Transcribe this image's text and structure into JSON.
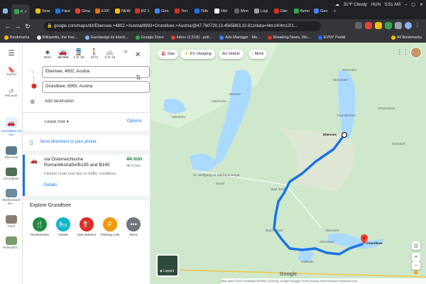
{
  "browser": {
    "tabs": [
      "K",
      "Sear",
      "Face",
      "Gma",
      "EXP",
      "NEW",
      "BZ 1",
      "Goo",
      "Terr",
      "Tele",
      "Hiki",
      "Meri",
      "Logi",
      "Dav",
      "Beno",
      "Goo"
    ],
    "active_tab": "K",
    "weather": "31°F  Cloudy",
    "time": "5:51 AM",
    "lang": "HUN",
    "url": "google.com/maps/dir/Ebensee,+4802,+Austria/8993+Grundlsee,+Austria/@47.760729,13.4565863,10.81z/data=!4m14!4m13!1...",
    "bookmarks": [
      "Bookmarks",
      "Wikipedia, the free...",
      "Gazdasági és közöt...",
      "Google Drive",
      "Inbox (2,518) - poll...",
      "Ads Manager - Me...",
      "Breaking News, Wo...",
      "EVNY Portál"
    ],
    "all_bookmarks": "All Bookmarks"
  },
  "rail": {
    "items": [
      {
        "label": "Saved",
        "icon": "bookmark-icon"
      },
      {
        "label": "Recents",
        "icon": "history-icon"
      },
      {
        "label": "Grundlsee 44 min",
        "icon": "car-icon"
      },
      {
        "label": "Ebensee"
      },
      {
        "label": "Grundlsee"
      },
      {
        "label": "Weißenbach am..."
      },
      {
        "label": "Paris"
      },
      {
        "label": "Hirtenalm..."
      }
    ]
  },
  "directions": {
    "modes": [
      {
        "label": "Best",
        "glyph": "◈"
      },
      {
        "label": "44 min",
        "glyph": "🚗"
      },
      {
        "label": "1 hr 28",
        "glyph": "🚆"
      },
      {
        "label": "16 hr",
        "glyph": "🚶"
      },
      {
        "label": "2 hr 44",
        "glyph": "🚲"
      },
      {
        "label": "",
        "glyph": "✈"
      }
    ],
    "origin": "Ebensee, 4802, Austria",
    "destination": "Grundlsee, 8993, Austria",
    "add_destination": "Add destination",
    "leave_now": "Leave now",
    "options": "Options",
    "send_phone": "Send directions to your phone",
    "route": {
      "via": "via Österreichische Romantikstraße/B145 and B145",
      "time": "44 min",
      "distance": "46.5 km",
      "note": "Fastest route now due to traffic conditions",
      "details": "Details"
    },
    "explore": {
      "title": "Explore Grundlsee",
      "categories": [
        {
          "label": "Restaurants",
          "glyph": "🍴",
          "color": "#1e8e3e"
        },
        {
          "label": "Hotels",
          "glyph": "🛏",
          "color": "#12b5cb"
        },
        {
          "label": "Gas stations",
          "glyph": "⛽",
          "color": "#d93025"
        },
        {
          "label": "Parking Lots",
          "glyph": "P",
          "color": "#f29900"
        },
        {
          "label": "More",
          "glyph": "•••",
          "color": "#70757a"
        }
      ]
    }
  },
  "map": {
    "chips": [
      "Gas",
      "EV charging",
      "Hotels",
      "More"
    ],
    "labels": {
      "ebensee": "Ebensee",
      "grundlsee": "Grundlsee",
      "bad_ischl": "Bad Ischl",
      "bad_aussee": "Bad Aussee",
      "altmunster": "Altmünster",
      "gmunden": "Gmunden",
      "traunkirchen": "Traunkirchen",
      "strobl": "Strobl",
      "st_wolfgang": "St. Wolfgang im Salzkammergut",
      "mondsee": "Mondsee",
      "attersee": "Attersee",
      "oberhofen": "Oberhofen",
      "altaussee": "Altaussee",
      "obertraun": "Obertraun",
      "scharnstein": "Scharnstein",
      "kirchdorf": "Kirchdorf",
      "hallstatt": "Hallstatt"
    },
    "layers": "Layers",
    "footer": "Map data ©2023 GeoBasis-DE/BKG (©2009), Google   Hungary   Terms   Privacy   Send Product Feedback   5 km",
    "google": "Google"
  },
  "colors": {
    "route": "#1a73e8",
    "water": "#aadaff",
    "land": "#cfe8cc",
    "accent": "#1a73e8"
  }
}
